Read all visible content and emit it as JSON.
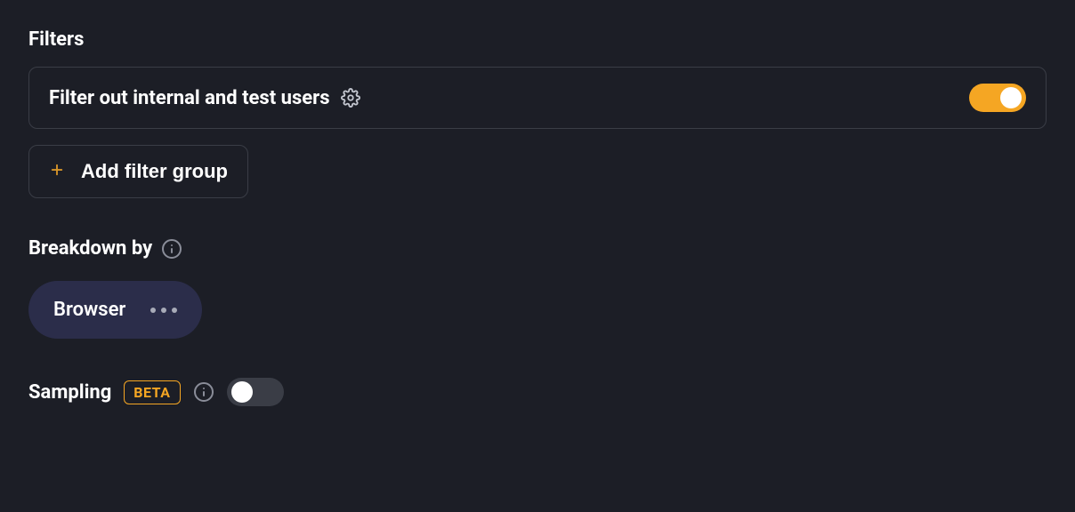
{
  "filters": {
    "title": "Filters",
    "internalUsers": {
      "label": "Filter out internal and test users",
      "enabled": true
    },
    "addFilterGroup": "Add filter group"
  },
  "breakdown": {
    "title": "Breakdown by",
    "chip": "Browser"
  },
  "sampling": {
    "title": "Sampling",
    "badge": "BETA",
    "enabled": false
  }
}
